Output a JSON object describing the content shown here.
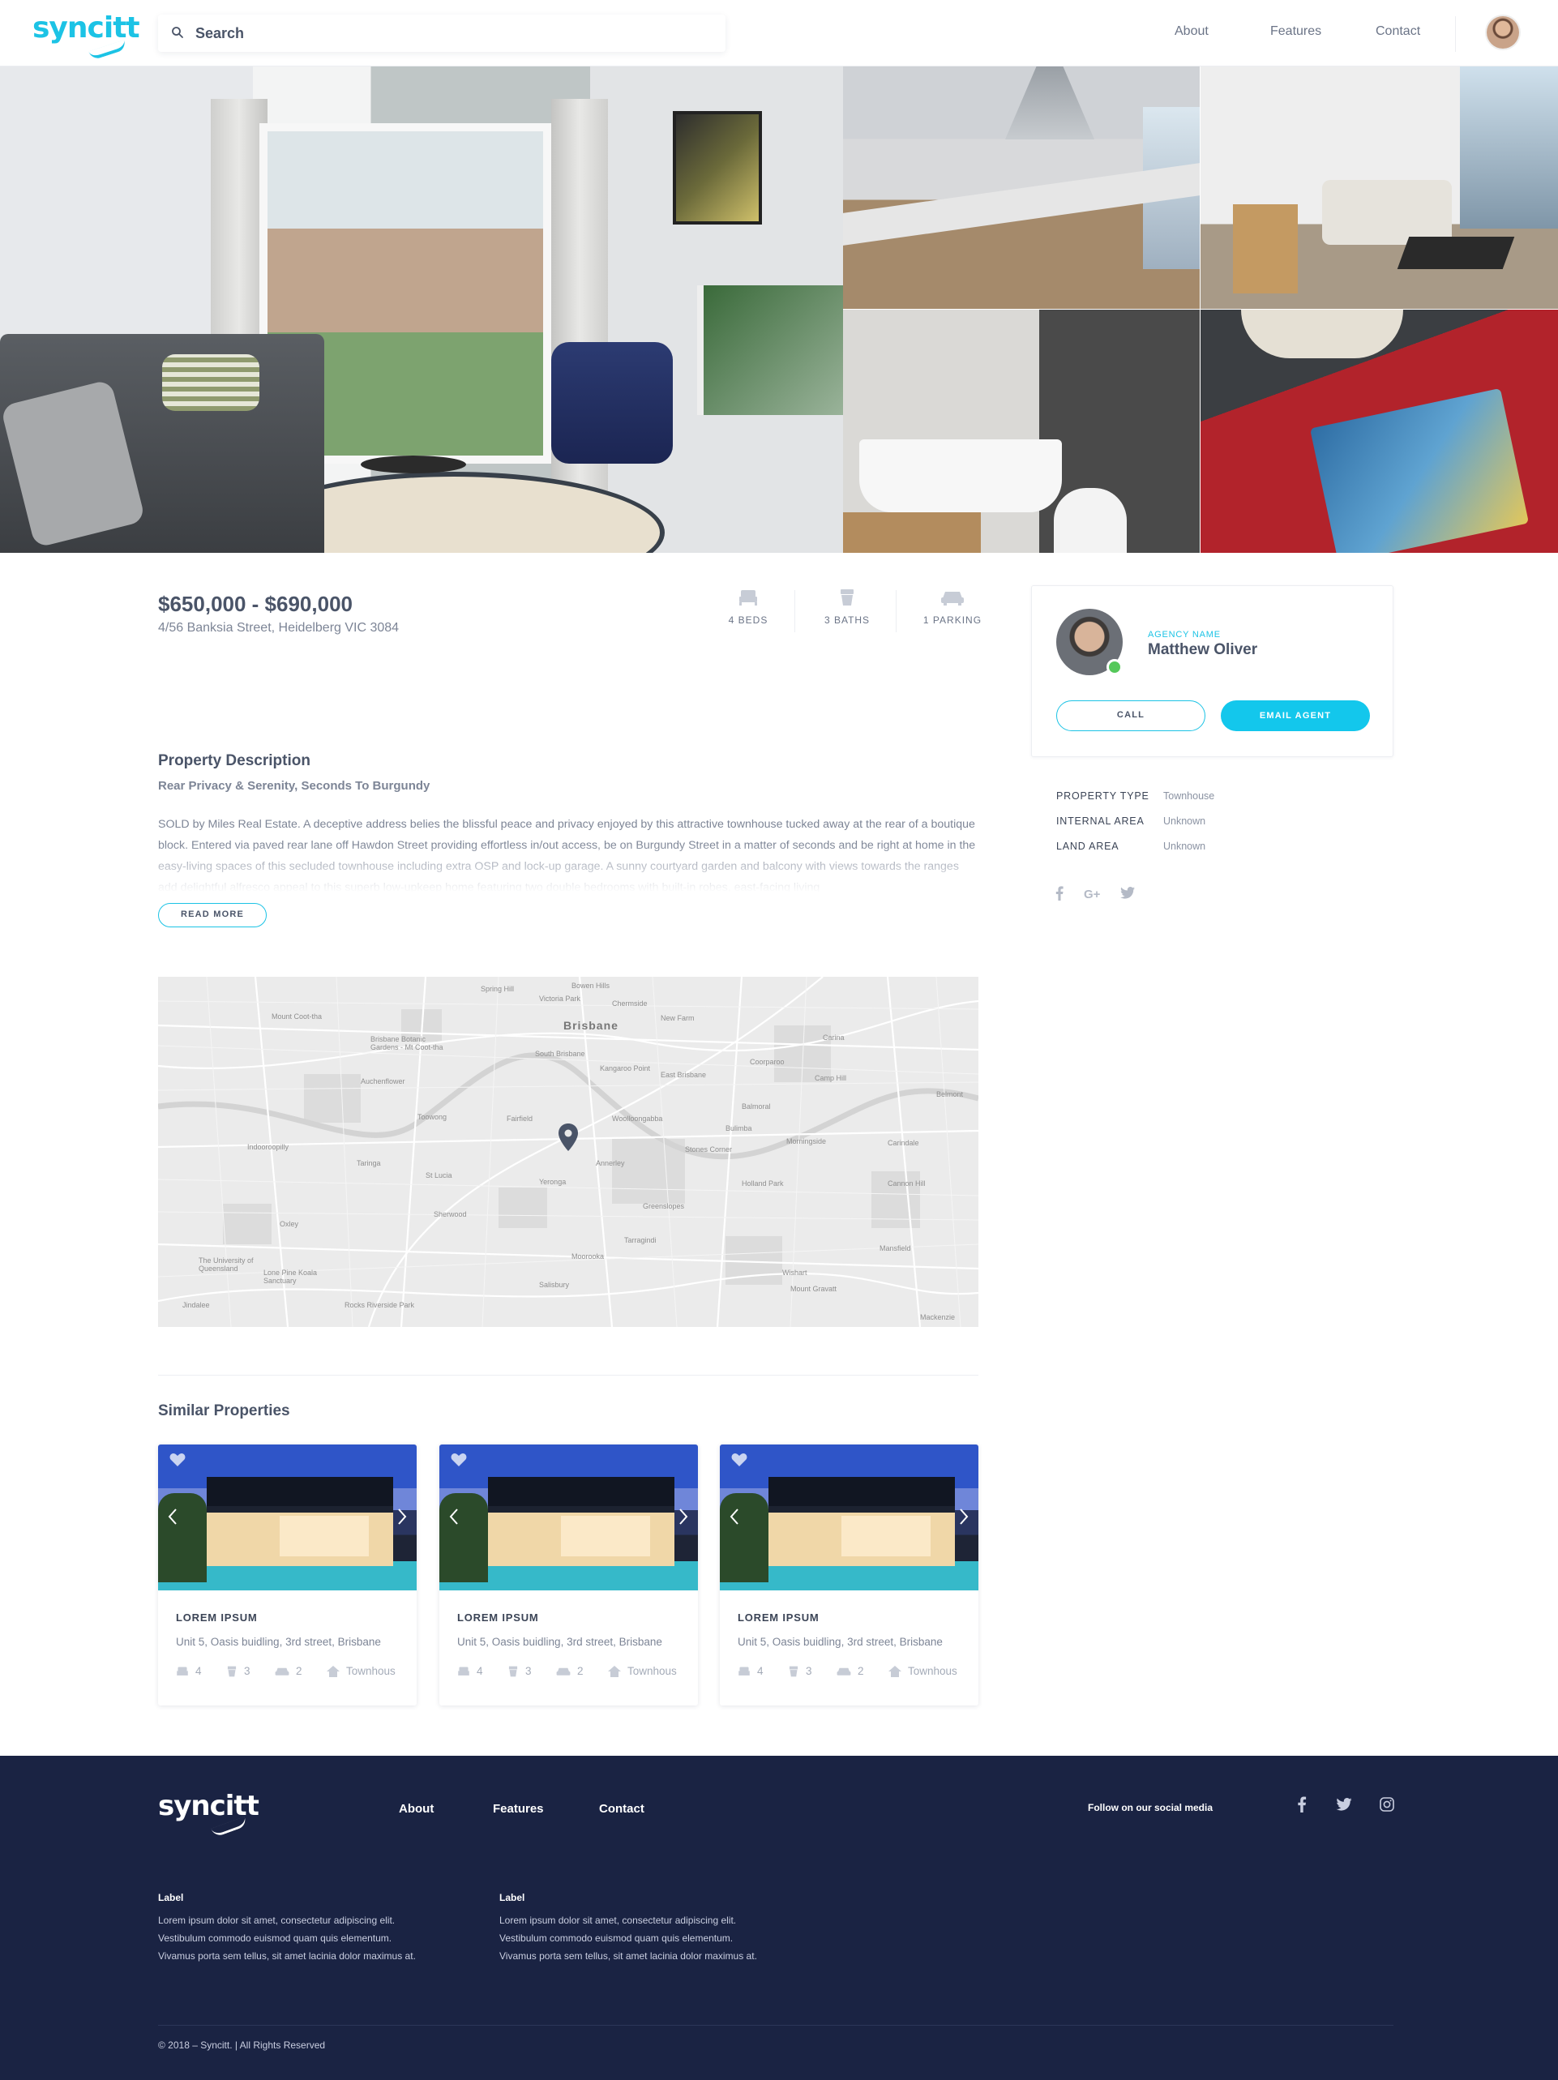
{
  "header": {
    "logo": "syncitt",
    "search_placeholder": "Search",
    "nav": [
      "About",
      "Features",
      "Contact"
    ]
  },
  "listing": {
    "price": "$650,000 - $690,000",
    "address": "4/56 Banksia Street, Heidelberg VIC 3084",
    "features": [
      {
        "icon": "bed-icon",
        "label": "4 BEDS"
      },
      {
        "icon": "bath-icon",
        "label": "3 BATHS"
      },
      {
        "icon": "car-icon",
        "label": "1 PARKING"
      }
    ]
  },
  "description": {
    "title": "Property Description",
    "subtitle": "Rear Privacy & Serenity, Seconds To Burgundy",
    "body": "SOLD by Miles Real Estate. A deceptive address belies the blissful peace and privacy enjoyed by this attractive townhouse tucked away at the rear of a boutique block. Entered via paved rear lane off Hawdon Street providing effortless in/out access, be on Burgundy Street in a matter of seconds and be right at home in the easy-living spaces of this secluded townhouse including extra OSP and lock-up garage. A sunny courtyard garden and balcony with views towards the ranges add delightful alfresco appeal to this superb low-upkeep home featuring two double bedrooms with built-in robes, east-facing living",
    "read_more": "READ MORE"
  },
  "map": {
    "city": "Brisbane",
    "labels": [
      "Spring Hill",
      "Victoria Park",
      "Bowen Hills",
      "New Farm",
      "Brisbane Botanic Gardens - Mt Coot-tha",
      "Mount Coot-tha",
      "Toowong",
      "Auchenflower",
      "Kangaroo Point",
      "South Brisbane",
      "Woolloongabba",
      "East Brisbane",
      "Coorparoo",
      "Camp Hill",
      "Carina",
      "Cannon Hill",
      "Indooroopilly",
      "Taringa",
      "St Lucia",
      "Yeronga",
      "Tarragindi",
      "Holland Park",
      "Mount Gravatt",
      "Mansfield",
      "Carindale",
      "The University of Queensland",
      "Sherwood",
      "Oxley",
      "Moorooka",
      "Salisbury",
      "Greenslopes",
      "Annerley",
      "Fairfield",
      "Bulimba",
      "Morningside",
      "Balmoral",
      "Wishart",
      "Chermside",
      "Lone Pine Koala Sanctuary",
      "Rocks Riverside Park",
      "Jindalee",
      "Mackenzie",
      "Belmont",
      "Stones Corner"
    ]
  },
  "similar": {
    "title": "Similar Properties",
    "cards": [
      {
        "name": "LOREM IPSUM",
        "address": "Unit 5, Oasis buidling, 3rd street, Brisbane",
        "beds": "4",
        "baths": "3",
        "parking": "2",
        "type": "Townhous"
      },
      {
        "name": "LOREM IPSUM",
        "address": "Unit 5, Oasis buidling, 3rd street, Brisbane",
        "beds": "4",
        "baths": "3",
        "parking": "2",
        "type": "Townhous"
      },
      {
        "name": "LOREM IPSUM",
        "address": "Unit 5, Oasis buidling, 3rd street, Brisbane",
        "beds": "4",
        "baths": "3",
        "parking": "2",
        "type": "Townhous"
      }
    ]
  },
  "agent": {
    "agency_label": "AGENCY NAME",
    "name": "Matthew Oliver",
    "call": "CALL",
    "email": "EMAIL AGENT",
    "status_color": "#55c85a"
  },
  "properties": [
    {
      "key": "PROPERTY TYPE",
      "value": "Townhouse"
    },
    {
      "key": "INTERNAL AREA",
      "value": "Unknown"
    },
    {
      "key": "LAND AREA",
      "value": "Unknown"
    }
  ],
  "share_icons": [
    "facebook-icon",
    "google-plus-icon",
    "twitter-icon"
  ],
  "footer": {
    "logo": "syncitt",
    "nav": [
      "About",
      "Features",
      "Contact"
    ],
    "follow": "Follow on our social media",
    "social_icons": [
      "facebook-icon",
      "twitter-icon",
      "instagram-icon"
    ],
    "columns": [
      {
        "label": "Label",
        "lines": [
          "Lorem ipsum dolor sit amet, consectetur adipiscing elit.",
          "Vestibulum commodo euismod quam quis elementum.",
          "Vivamus porta sem tellus, sit amet lacinia dolor maximus at."
        ]
      },
      {
        "label": "Label",
        "lines": [
          "Lorem ipsum dolor sit amet, consectetur adipiscing elit.",
          "Vestibulum commodo euismod quam quis elementum.",
          "Vivamus porta sem tellus, sit amet lacinia dolor maximus at."
        ]
      }
    ],
    "copyright": "© 2018 – Syncitt. | All Rights Reserved"
  },
  "colors": {
    "accent": "#1cc3e5",
    "button": "#13c7ec",
    "text": "#4a5468",
    "footer_bg": "#1a2343"
  }
}
